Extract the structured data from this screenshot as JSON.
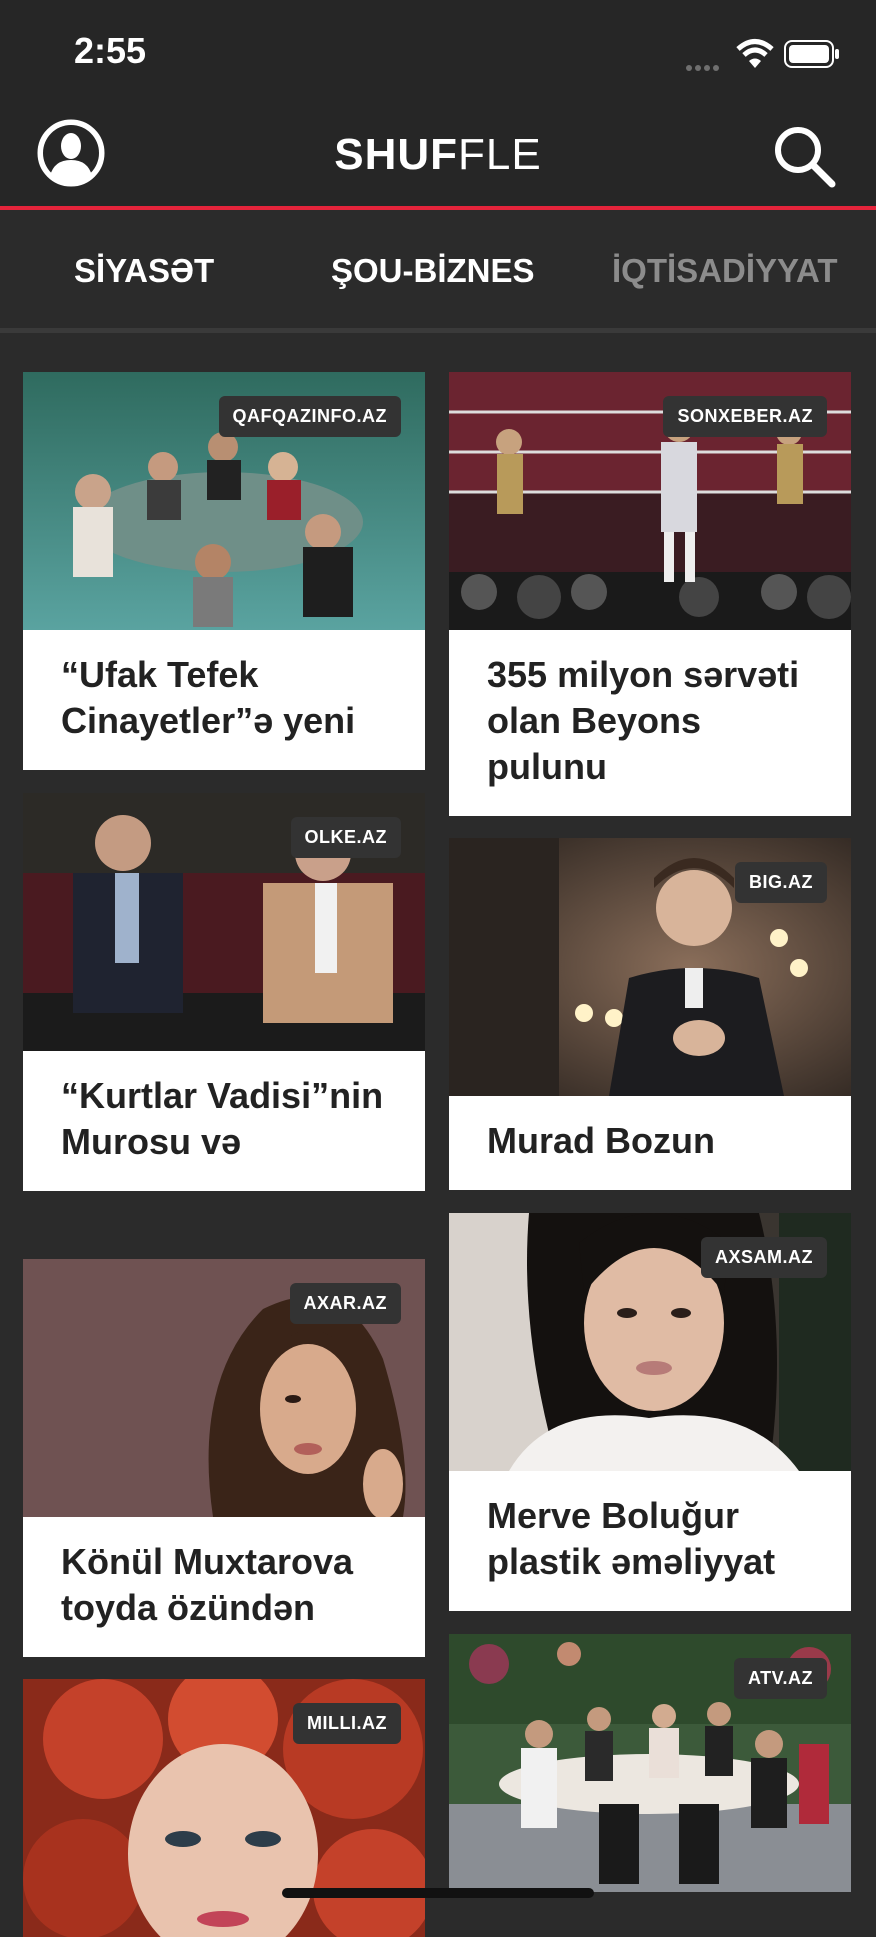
{
  "status": {
    "time": "2:55"
  },
  "header": {
    "logo_bold": "SHUF",
    "logo_thin": "FLE"
  },
  "tabs": [
    "SİYASƏT",
    "ŞOU-BİZNES",
    "İQTİSADİYYAT"
  ],
  "cards": [
    {
      "source": "QAFQAZINFO.AZ",
      "title": "“Ufak Tefek Cinayetler”ə yeni"
    },
    {
      "source": "SONXEBER.AZ",
      "title": "355 milyon sərvəti olan Beyons pulunu"
    },
    {
      "source": "OLKE.AZ",
      "title": "“Kurtlar Vadisi”nin Murosu və"
    },
    {
      "source": "BIG.AZ",
      "title": "Murad Bozun"
    },
    {
      "source": "AXAR.AZ",
      "title": "Könül Muxtarova toyda özündən"
    },
    {
      "source": "AXSAM.AZ",
      "title": " Merve Boluğur plastik əməliyyat"
    },
    {
      "source": "MILLI.AZ",
      "title": ""
    },
    {
      "source": "ATV.AZ",
      "title": ""
    }
  ],
  "colors": {
    "accent": "#e5243b",
    "background": "#2b2b2b",
    "header": "#262626"
  },
  "icons": [
    "profile-icon",
    "search-icon",
    "wifi-icon",
    "battery-icon"
  ]
}
